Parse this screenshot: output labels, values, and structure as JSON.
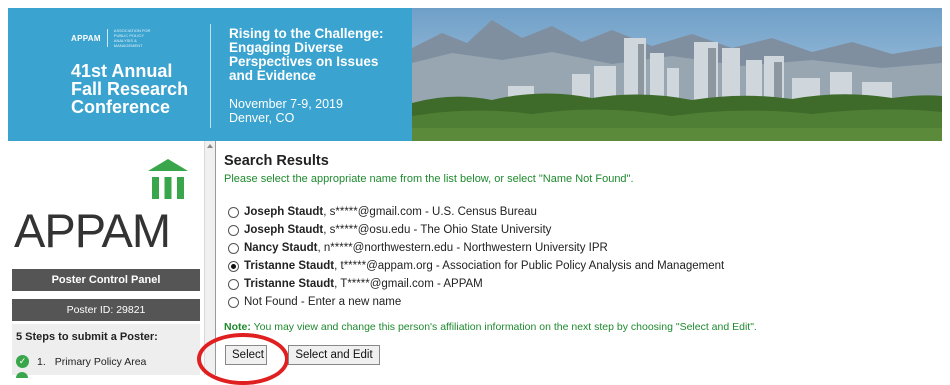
{
  "banner": {
    "org_logo_text": "APPAM",
    "org_logo_small": "ASSOCIATION FOR PUBLIC POLICY ANALYSIS & MANAGEMENT",
    "conference_line1": "41st Annual",
    "conference_line2": "Fall Research",
    "conference_line3": "Conference",
    "title_line1": "Rising to the Challenge:",
    "title_line2": "Engaging Diverse",
    "title_line3": "Perspectives on Issues",
    "title_line4": "and Evidence",
    "date": "November 7-9, 2019",
    "location": "Denver, CO",
    "colors": {
      "banner_blue": "#3aa3cf"
    }
  },
  "sidebar": {
    "logo_text": "APPAM",
    "control_panel_label": "Poster Control Panel",
    "poster_id": "Poster ID: 29821",
    "steps_title": "5 Steps to submit a Poster:",
    "steps": [
      {
        "number": "1.",
        "label": "Primary Policy Area",
        "status": "complete"
      }
    ],
    "colors": {
      "accent_green": "#3aa64b",
      "bar_gray": "#555555"
    }
  },
  "main": {
    "title": "Search Results",
    "instruction": "Please select the appropriate name from the list below, or select \"Name Not Found\".",
    "options": [
      {
        "name": "Joseph Staudt",
        "detail": ", s*****@gmail.com - U.S. Census Bureau",
        "selected": false
      },
      {
        "name": "Joseph Staudt",
        "detail": ", s*****@osu.edu - The Ohio State University",
        "selected": false
      },
      {
        "name": "Nancy Staudt",
        "detail": ", n*****@northwestern.edu - Northwestern University IPR",
        "selected": false
      },
      {
        "name": "Tristanne Staudt",
        "detail": ", t*****@appam.org - Association for Public Policy Analysis and Management",
        "selected": true
      },
      {
        "name": "Tristanne Staudt",
        "detail": ", T*****@gmail.com - APPAM",
        "selected": false
      },
      {
        "name": "",
        "detail": "Not Found - Enter a new name",
        "selected": false
      }
    ],
    "note_label": "Note:",
    "note_text": " You may view and change this person's affiliation information on the next step by choosing \"Select and Edit\".",
    "buttons": {
      "select": "Select",
      "select_and_edit": "Select and Edit"
    },
    "colors": {
      "instruction_green": "#1e8a2e",
      "highlight_red": "#e02020"
    }
  }
}
